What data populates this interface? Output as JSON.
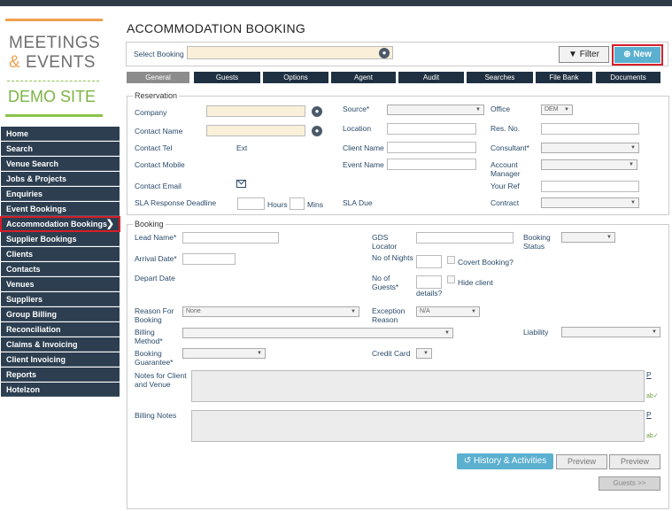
{
  "brand": {
    "line1": "MEETINGS",
    "amp": "&",
    "line2": " EVENTS",
    "line3": "DEMO SITE"
  },
  "page_title": "ACCOMMODATION BOOKING",
  "select_booking": {
    "label": "Select Booking",
    "value": ""
  },
  "buttons": {
    "filter": "Filter",
    "new": "New",
    "history": "History & Activities",
    "preview1": "Preview",
    "preview2": "Preview",
    "guests": "Guests >>"
  },
  "nav": [
    "Home",
    "Search",
    "Venue Search",
    "Jobs & Projects",
    "Enquiries",
    "Event Bookings",
    "Accommodation Bookings",
    "Supplier Bookings",
    "Clients",
    "Contacts",
    "Venues",
    "Suppliers",
    "Group Billing",
    "Reconciliation",
    "Claims & Invoicing",
    "Client Invoicing",
    "Reports",
    "Hotelzon"
  ],
  "tabs": [
    "General",
    "Guests",
    "Options",
    "Agent",
    "Audit",
    "Searches",
    "File Bank",
    "Documents"
  ],
  "reservation": {
    "legend": "Reservation",
    "company": "Company",
    "contact_name": "Contact Name",
    "contact_tel": "Contact Tel",
    "ext": "Ext",
    "contact_mobile": "Contact Mobile",
    "contact_email": "Contact Email",
    "sla": "SLA Response Deadline",
    "hours": "Hours",
    "mins": "Mins",
    "source": "Source*",
    "location": "Location",
    "client_name": "Client Name",
    "event_name": "Event Name",
    "sla_due": "SLA Due",
    "office": "Office",
    "office_value": "DEM",
    "res_no": "Res. No.",
    "consultant": "Consultant*",
    "account_manager": "Account Manager",
    "your_ref": "Your Ref",
    "contract": "Contract"
  },
  "booking": {
    "legend": "Booking",
    "lead_name": "Lead Name*",
    "arrival_date": "Arrival Date*",
    "depart_date": "Depart Date",
    "reason_for_booking": "Reason For Booking",
    "reason_value": "None",
    "billing_method": "Billing Method*",
    "booking_guarantee": "Booking Guarantee*",
    "notes_client": "Notes for Client and Venue",
    "billing_notes": "Billing Notes",
    "gds": "GDS Locator",
    "nights": "No of Nights",
    "covert": "Covert Booking?",
    "guests": "No of Guests*",
    "hide_client": "Hide client",
    "details": "details?",
    "exception_reason": "Exception Reason",
    "exception_value": "N/A",
    "credit_card": "Credit Card",
    "booking_status": "Booking Status",
    "liability": "Liability",
    "p1": "P",
    "p2": "P"
  }
}
